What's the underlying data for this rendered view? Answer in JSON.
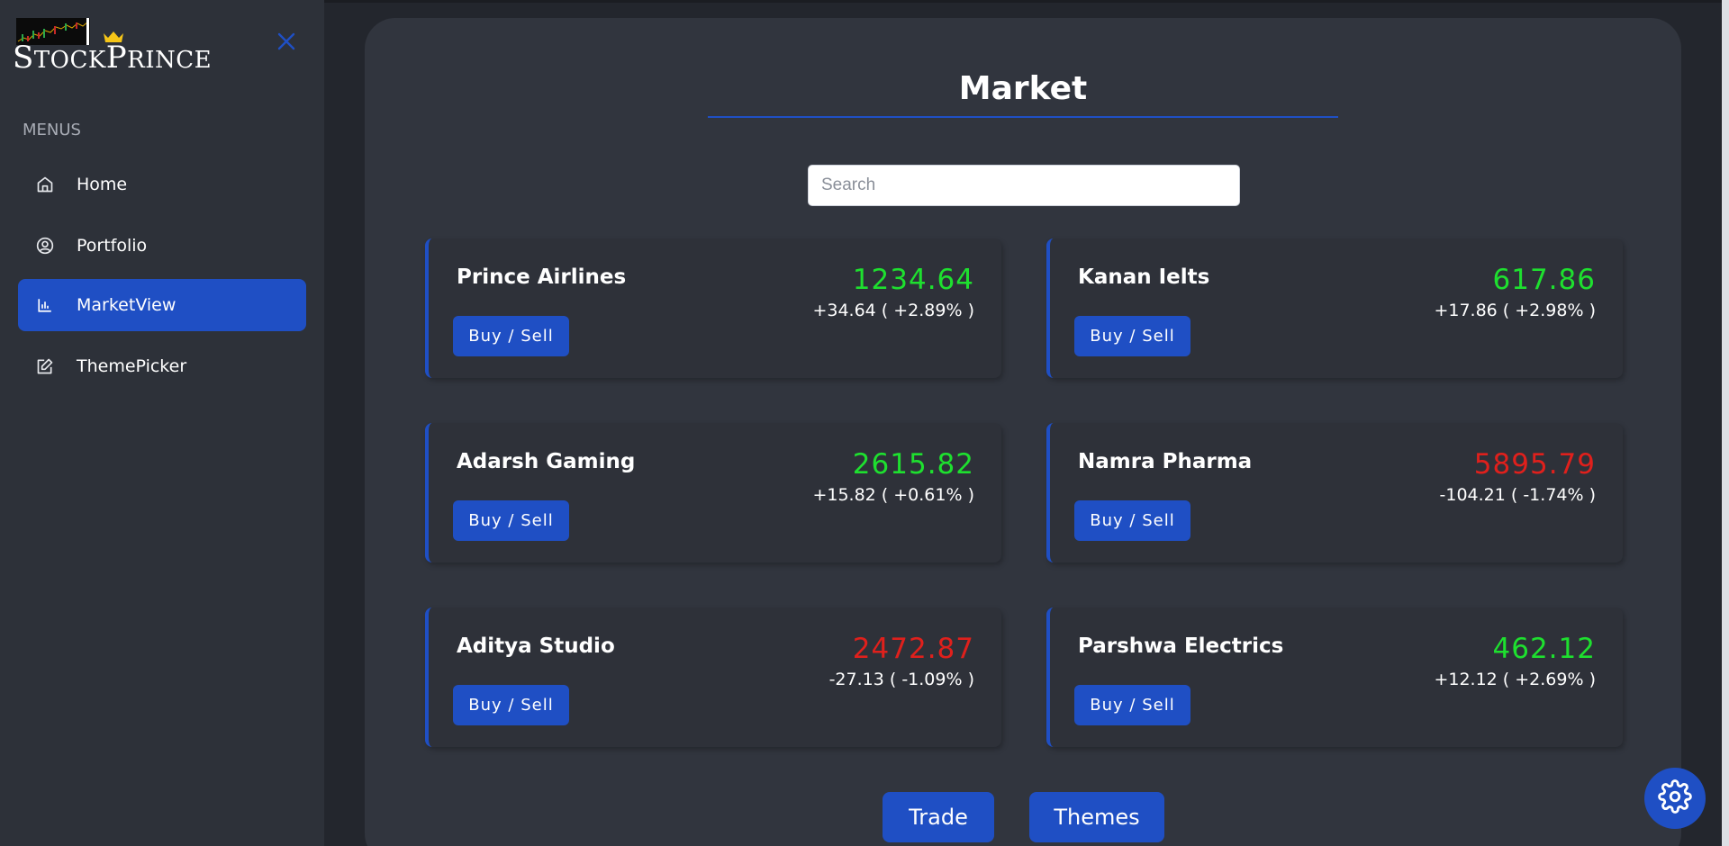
{
  "brand": {
    "name_first": "S",
    "name_rest1": "TOCK",
    "name_mid": "P",
    "name_rest2": "RINCE",
    "crown_icon": "crown-icon"
  },
  "sidebar": {
    "close_icon": "close-icon",
    "menus_label": "MENUS",
    "items": [
      {
        "label": "Home",
        "icon": "home-icon",
        "active": false
      },
      {
        "label": "Portfolio",
        "icon": "user-circle-icon",
        "active": false
      },
      {
        "label": "MarketView",
        "icon": "bar-chart-icon",
        "active": true
      },
      {
        "label": "ThemePicker",
        "icon": "edit-icon",
        "active": false
      }
    ]
  },
  "main": {
    "title": "Market",
    "search": {
      "placeholder": "Search",
      "value": ""
    },
    "stocks": [
      {
        "name": "Prince Airlines",
        "price": "1234.64",
        "change": "+34.64 ( +2.89% )",
        "trend": "up",
        "button": "Buy / Sell"
      },
      {
        "name": "Kanan Ielts",
        "price": "617.86",
        "change": "+17.86 ( +2.98% )",
        "trend": "up",
        "button": "Buy / Sell"
      },
      {
        "name": "Adarsh Gaming",
        "price": "2615.82",
        "change": "+15.82 ( +0.61% )",
        "trend": "up",
        "button": "Buy / Sell"
      },
      {
        "name": "Namra Pharma",
        "price": "5895.79",
        "change": "-104.21 ( -1.74% )",
        "trend": "down",
        "button": "Buy / Sell"
      },
      {
        "name": "Aditya Studio",
        "price": "2472.87",
        "change": "-27.13 ( -1.09% )",
        "trend": "down",
        "button": "Buy / Sell"
      },
      {
        "name": "Parshwa Electrics",
        "price": "462.12",
        "change": "+12.12 ( +2.69% )",
        "trend": "up",
        "button": "Buy / Sell"
      }
    ],
    "trade_label": "Trade",
    "themes_label": "Themes"
  },
  "settings_icon": "gear-icon",
  "colors": {
    "accent": "#1f4fc4",
    "up": "#1ee02f",
    "down": "#e0201c",
    "panel": "#31353e",
    "sidebar": "#2d3139"
  }
}
